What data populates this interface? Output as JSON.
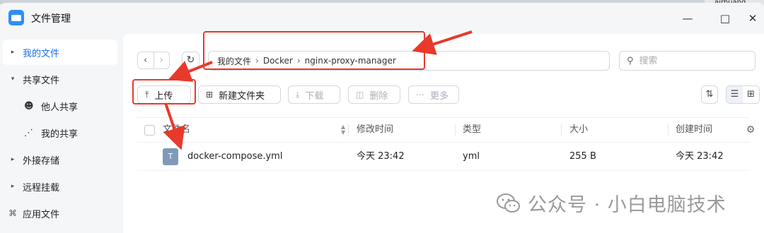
{
  "window": {
    "title": "文件管理",
    "corner_text": "airhuang",
    "icons": {
      "minimize": "minimize-icon",
      "maximize": "maximize-icon",
      "close": "close-icon"
    }
  },
  "sidebar": {
    "items": [
      {
        "label": "我的文件",
        "icon": "caret-right-icon",
        "active": true
      },
      {
        "label": "共享文件",
        "icon": "caret-down-icon",
        "active": false
      },
      {
        "label": "他人共享",
        "icon": "users-icon",
        "sub": true
      },
      {
        "label": "我的共享",
        "icon": "share-icon",
        "sub": true
      },
      {
        "label": "外接存储",
        "icon": "caret-right-icon",
        "active": false
      },
      {
        "label": "远程挂载",
        "icon": "caret-right-icon",
        "active": false
      },
      {
        "label": "应用文件",
        "icon": "apps-icon",
        "active": false
      }
    ]
  },
  "toolbar": {
    "breadcrumb": [
      "我的文件",
      "Docker",
      "nginx-proxy-manager"
    ],
    "search_placeholder": "搜索",
    "buttons": [
      {
        "label": "上传",
        "icon": "upload-icon",
        "enabled": true
      },
      {
        "label": "新建文件夹",
        "icon": "new-folder-icon",
        "enabled": true
      },
      {
        "label": "下载",
        "icon": "download-icon",
        "enabled": false
      },
      {
        "label": "删除",
        "icon": "trash-icon",
        "enabled": false
      },
      {
        "label": "更多",
        "icon": "more-icon",
        "enabled": false
      }
    ],
    "view_icons": [
      "sort-icon",
      "list-view-icon",
      "grid-view-icon"
    ]
  },
  "table": {
    "columns": [
      "文件名",
      "修改时间",
      "类型",
      "大小",
      "创建时间"
    ],
    "rows": [
      {
        "name": "docker-compose.yml",
        "modified": "今天 23:42",
        "type": "yml",
        "size": "255 B",
        "created": "今天 23:42",
        "icon": "text-file-icon"
      }
    ]
  },
  "watermark": {
    "text": "公众号 · 小白电脑技术"
  },
  "colors": {
    "accent": "#1a6ef0",
    "annotation": "#e8392a"
  }
}
